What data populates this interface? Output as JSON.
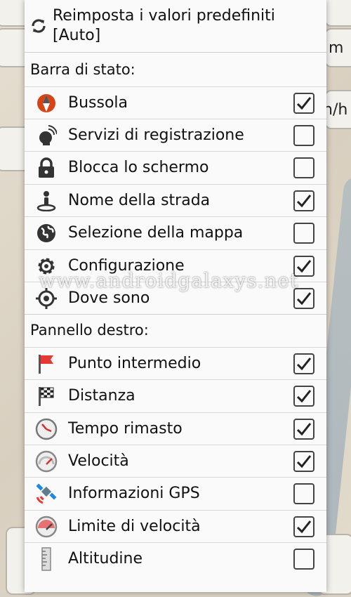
{
  "map": {
    "speed_unit_1": "m",
    "speed_unit_2": "n/h"
  },
  "reset": {
    "label": "Reimposta i valori predefiniti [Auto]",
    "icon": "refresh-icon"
  },
  "sections": {
    "status_bar": "Barra di stato:",
    "right_panel": "Pannello destro:"
  },
  "status_items": [
    {
      "label": "Bussola",
      "icon": "compass-icon",
      "checked": true
    },
    {
      "label": "Servizi di registrazione",
      "icon": "satellite-dish-icon",
      "checked": false
    },
    {
      "label": "Blocca lo schermo",
      "icon": "lock-icon",
      "checked": false
    },
    {
      "label": "Nome della strada",
      "icon": "person-pin-icon",
      "checked": true
    },
    {
      "label": "Selezione della mappa",
      "icon": "globe-icon",
      "checked": false
    },
    {
      "label": "Configurazione",
      "icon": "gear-icon",
      "checked": true
    },
    {
      "label": "Dove sono",
      "icon": "crosshair-icon",
      "checked": true
    }
  ],
  "panel_items": [
    {
      "label": "Punto intermedio",
      "icon": "red-flag-icon",
      "checked": true
    },
    {
      "label": "Distanza",
      "icon": "checkered-flag-icon",
      "checked": true
    },
    {
      "label": "Tempo rimasto",
      "icon": "clock-icon",
      "checked": true
    },
    {
      "label": "Velocità",
      "icon": "speedometer-icon",
      "checked": true
    },
    {
      "label": "Informazioni GPS",
      "icon": "gps-satellite-icon",
      "checked": false
    },
    {
      "label": "Limite di velocità",
      "icon": "speed-limit-icon",
      "checked": true
    },
    {
      "label": "Altitudine",
      "icon": "ruler-icon",
      "checked": false
    }
  ],
  "watermark": "www.androidgalaxys.net"
}
